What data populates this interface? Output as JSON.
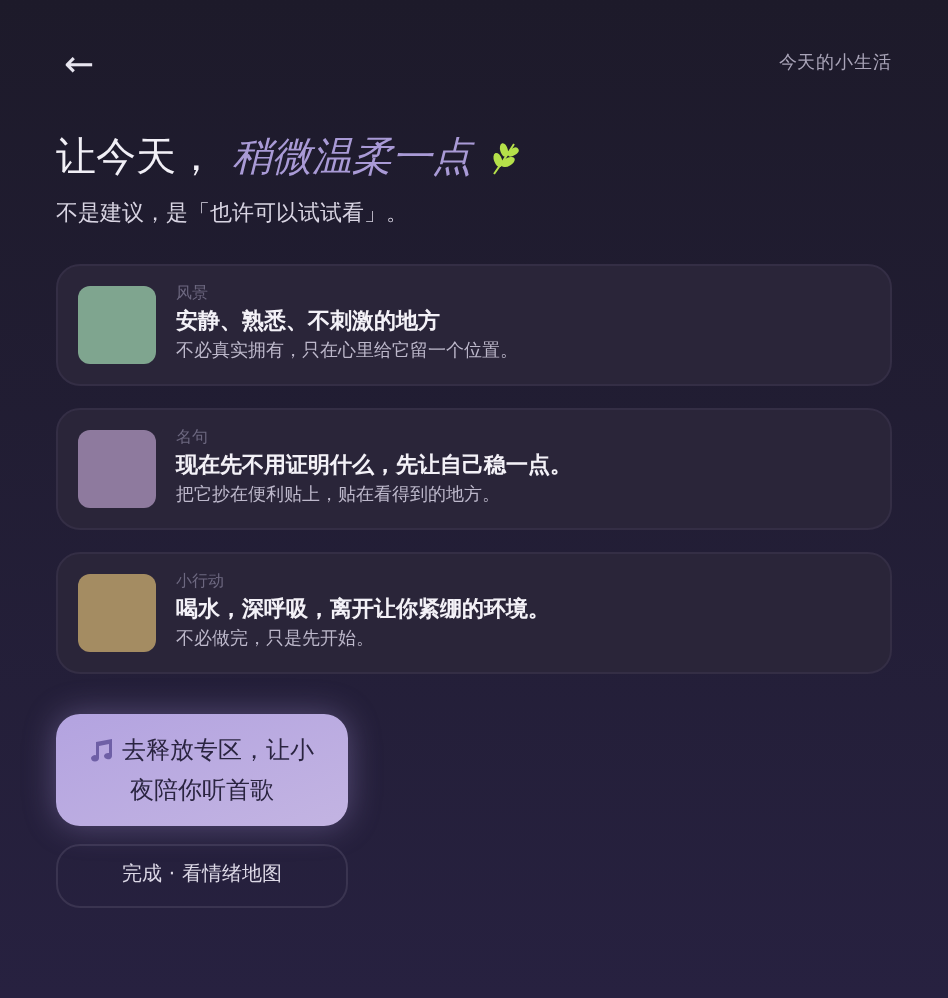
{
  "header": {
    "back": "←",
    "title": "今天的小生活"
  },
  "heading": {
    "lead": "让今天，",
    "accent": "稍微温柔一点"
  },
  "subtitle": "不是建议，是「也许可以试试看」。",
  "cards": [
    {
      "tag": "风景",
      "title": "安静、熟悉、不刺激的地方",
      "note": "不必真实拥有，只在心里给它留一个位置。",
      "color": "#7fa58f"
    },
    {
      "tag": "名句",
      "title": "现在先不用证明什么，先让自己稳一点。",
      "note": "把它抄在便利贴上，贴在看得到的地方。",
      "color": "#8e7a9e"
    },
    {
      "tag": "小行动",
      "title": "喝水，深呼吸，离开让你紧绷的环境。",
      "note": "不必做完，只是先开始。",
      "color": "#a48c62"
    }
  ],
  "primary_button": "去释放专区，让小夜陪你听首歌",
  "secondary_button": "完成 · 看情绪地图"
}
